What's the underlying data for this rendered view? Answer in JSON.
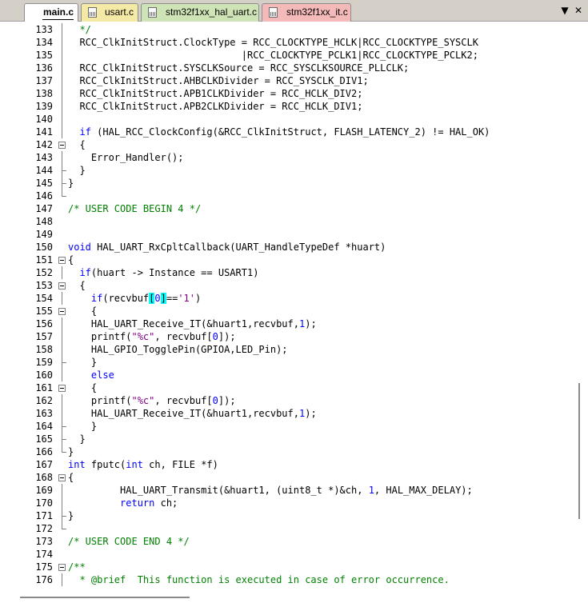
{
  "tabs": [
    {
      "label": "main.c",
      "active": true,
      "color": "#ffffff"
    },
    {
      "label": "usart.c",
      "active": false,
      "color": "#f5e9a6"
    },
    {
      "label": "stm32f1xx_hal_uart.c",
      "active": false,
      "color": "#cfe4b6"
    },
    {
      "label": "stm32f1xx_it.c",
      "active": false,
      "color": "#f4b9b9"
    }
  ],
  "tab_controls": {
    "dropdown": "▼",
    "close": "✕"
  },
  "lines": [
    {
      "n": "133",
      "fold": "line",
      "segs": [
        [
          "c",
          "  */"
        ]
      ]
    },
    {
      "n": "134",
      "fold": "line",
      "segs": [
        [
          "n",
          "  RCC_ClkInitStruct.ClockType = RCC_CLOCKTYPE_HCLK|RCC_CLOCKTYPE_SYSCLK"
        ]
      ]
    },
    {
      "n": "135",
      "fold": "line",
      "segs": [
        [
          "n",
          "                              |RCC_CLOCKTYPE_PCLK1|RCC_CLOCKTYPE_PCLK2;"
        ]
      ]
    },
    {
      "n": "136",
      "fold": "line",
      "segs": [
        [
          "n",
          "  RCC_ClkInitStruct.SYSCLKSource = RCC_SYSCLKSOURCE_PLLCLK;"
        ]
      ]
    },
    {
      "n": "137",
      "fold": "line",
      "segs": [
        [
          "n",
          "  RCC_ClkInitStruct.AHBCLKDivider = RCC_SYSCLK_DIV1;"
        ]
      ]
    },
    {
      "n": "138",
      "fold": "line",
      "segs": [
        [
          "n",
          "  RCC_ClkInitStruct.APB1CLKDivider = RCC_HCLK_DIV2;"
        ]
      ]
    },
    {
      "n": "139",
      "fold": "line",
      "segs": [
        [
          "n",
          "  RCC_ClkInitStruct.APB2CLKDivider = RCC_HCLK_DIV1;"
        ]
      ]
    },
    {
      "n": "140",
      "fold": "line",
      "segs": []
    },
    {
      "n": "141",
      "fold": "line",
      "segs": [
        [
          "k",
          "  if"
        ],
        [
          "n",
          " (HAL_RCC_ClockConfig(&RCC_ClkInitStruct, FLASH_LATENCY_2) != HAL_OK)"
        ]
      ]
    },
    {
      "n": "142",
      "fold": "box",
      "segs": [
        [
          "n",
          "  {"
        ]
      ]
    },
    {
      "n": "143",
      "fold": "line",
      "segs": [
        [
          "n",
          "    Error_Handler();"
        ]
      ]
    },
    {
      "n": "144",
      "fold": "tick",
      "segs": [
        [
          "n",
          "  }"
        ]
      ]
    },
    {
      "n": "145",
      "fold": "tick",
      "segs": [
        [
          "n",
          "}"
        ]
      ]
    },
    {
      "n": "146",
      "fold": "corner",
      "segs": []
    },
    {
      "n": "147",
      "fold": "none",
      "segs": [
        [
          "c",
          "/* USER CODE BEGIN 4 */"
        ]
      ]
    },
    {
      "n": "148",
      "fold": "none",
      "segs": []
    },
    {
      "n": "149",
      "fold": "none",
      "segs": []
    },
    {
      "n": "150",
      "fold": "none",
      "segs": [
        [
          "k",
          "void"
        ],
        [
          "n",
          " HAL_UART_RxCpltCallback(UART_HandleTypeDef *huart)"
        ]
      ]
    },
    {
      "n": "151",
      "fold": "box",
      "segs": [
        [
          "n",
          "{"
        ]
      ]
    },
    {
      "n": "152",
      "fold": "line",
      "segs": [
        [
          "k",
          "  if"
        ],
        [
          "n",
          "(huart -> Instance == USART1)"
        ]
      ]
    },
    {
      "n": "153",
      "fold": "box",
      "segs": [
        [
          "n",
          "  {"
        ]
      ]
    },
    {
      "n": "154",
      "fold": "line",
      "segs": [
        [
          "k",
          "    if"
        ],
        [
          "n",
          "(recvbuf"
        ],
        [
          "h",
          "["
        ],
        [
          "u",
          "0"
        ],
        [
          "h",
          "]"
        ],
        [
          "n",
          "=="
        ],
        [
          "s",
          "'1'"
        ],
        [
          "n",
          ")"
        ]
      ]
    },
    {
      "n": "155",
      "fold": "box",
      "segs": [
        [
          "n",
          "    {"
        ]
      ]
    },
    {
      "n": "156",
      "fold": "line",
      "segs": [
        [
          "n",
          "    HAL_UART_Receive_IT(&huart1,recvbuf,"
        ],
        [
          "u",
          "1"
        ],
        [
          "n",
          ");"
        ]
      ]
    },
    {
      "n": "157",
      "fold": "line",
      "segs": [
        [
          "n",
          "    printf("
        ],
        [
          "s",
          "\"%c\""
        ],
        [
          "n",
          ", recvbuf["
        ],
        [
          "u",
          "0"
        ],
        [
          "n",
          "]);"
        ]
      ]
    },
    {
      "n": "158",
      "fold": "line",
      "segs": [
        [
          "n",
          "    HAL_GPIO_TogglePin(GPIOA,LED_Pin);"
        ]
      ]
    },
    {
      "n": "159",
      "fold": "tick",
      "segs": [
        [
          "n",
          "    }"
        ]
      ]
    },
    {
      "n": "160",
      "fold": "line",
      "segs": [
        [
          "k",
          "    else"
        ]
      ]
    },
    {
      "n": "161",
      "fold": "box",
      "segs": [
        [
          "n",
          "    {"
        ]
      ]
    },
    {
      "n": "162",
      "fold": "line",
      "segs": [
        [
          "n",
          "    printf("
        ],
        [
          "s",
          "\"%c\""
        ],
        [
          "n",
          ", recvbuf["
        ],
        [
          "u",
          "0"
        ],
        [
          "n",
          "]);"
        ]
      ]
    },
    {
      "n": "163",
      "fold": "line",
      "segs": [
        [
          "n",
          "    HAL_UART_Receive_IT(&huart1,recvbuf,"
        ],
        [
          "u",
          "1"
        ],
        [
          "n",
          ");"
        ]
      ]
    },
    {
      "n": "164",
      "fold": "tick",
      "segs": [
        [
          "n",
          "    }"
        ]
      ]
    },
    {
      "n": "165",
      "fold": "tick",
      "segs": [
        [
          "n",
          "  }"
        ]
      ]
    },
    {
      "n": "166",
      "fold": "corner",
      "segs": [
        [
          "n",
          "}"
        ]
      ]
    },
    {
      "n": "167",
      "fold": "none",
      "segs": [
        [
          "k",
          "int"
        ],
        [
          "n",
          " fputc("
        ],
        [
          "k",
          "int"
        ],
        [
          "n",
          " ch, FILE *f)"
        ]
      ]
    },
    {
      "n": "168",
      "fold": "box",
      "segs": [
        [
          "n",
          "{"
        ]
      ]
    },
    {
      "n": "169",
      "fold": "line",
      "segs": [
        [
          "n",
          "         HAL_UART_Transmit(&huart1, (uint8_t *)&ch, "
        ],
        [
          "u",
          "1"
        ],
        [
          "n",
          ", HAL_MAX_DELAY);"
        ]
      ]
    },
    {
      "n": "170",
      "fold": "line",
      "segs": [
        [
          "k",
          "         return"
        ],
        [
          "n",
          " ch;"
        ]
      ]
    },
    {
      "n": "171",
      "fold": "tick",
      "segs": [
        [
          "n",
          "}"
        ]
      ]
    },
    {
      "n": "172",
      "fold": "corner",
      "segs": []
    },
    {
      "n": "173",
      "fold": "none",
      "segs": [
        [
          "c",
          "/* USER CODE END 4 */"
        ]
      ]
    },
    {
      "n": "174",
      "fold": "none",
      "segs": []
    },
    {
      "n": "175",
      "fold": "box",
      "segs": [
        [
          "c",
          "/**"
        ]
      ]
    },
    {
      "n": "176",
      "fold": "line",
      "segs": [
        [
          "c",
          "  * @brief  This function is executed in case of error occurrence."
        ]
      ]
    }
  ]
}
